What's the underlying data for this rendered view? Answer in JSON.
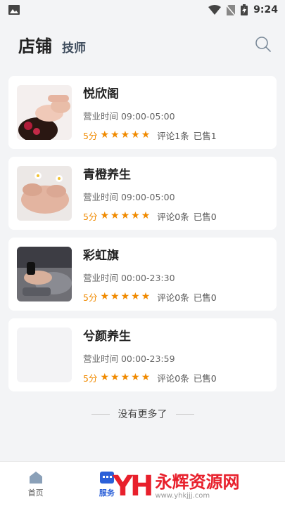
{
  "status_bar": {
    "time": "9:24"
  },
  "header": {
    "title": "店铺",
    "tab": "技师"
  },
  "shops": [
    {
      "name": "悦欣阁",
      "hours": "营业时间 09:00-05:00",
      "score": "5分",
      "reviews": "评论1条",
      "sold": "已售1",
      "image": "massage-face"
    },
    {
      "name": "青橙养生",
      "hours": "营业时间 09:00-05:00",
      "score": "5分",
      "reviews": "评论0条",
      "sold": "已售0",
      "image": "hand-massage"
    },
    {
      "name": "彩虹旗",
      "hours": "营业时间 00:00-23:30",
      "score": "5分",
      "reviews": "评论0条",
      "sold": "已售0",
      "image": "foot-spa"
    },
    {
      "name": "兮颜养生",
      "hours": "营业时间 00:00-23:59",
      "score": "5分",
      "reviews": "评论0条",
      "sold": "已售0",
      "image": "placeholder"
    }
  ],
  "end_text": "没有更多了",
  "tabbar": {
    "items": [
      {
        "label": "首页",
        "icon": "home-icon"
      },
      {
        "label": "服务",
        "icon": "service-icon"
      },
      {
        "label": "",
        "icon": ""
      },
      {
        "label": "",
        "icon": ""
      }
    ]
  },
  "watermark": {
    "logo": "YH",
    "text": "永辉资源网",
    "url": "www.yhkjjj.com"
  },
  "colors": {
    "accent": "#2b60d8",
    "star": "#f08a00",
    "watermark": "#e8202c"
  }
}
